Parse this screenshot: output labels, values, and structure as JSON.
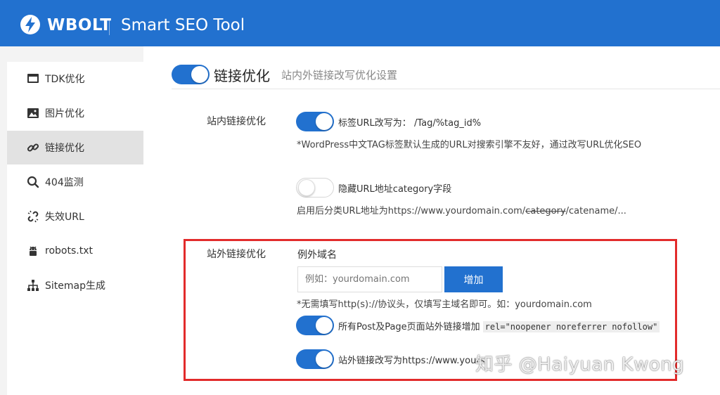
{
  "header": {
    "brand": "WBOLT",
    "product": "Smart SEO Tool",
    "accent_color": "#2271cf",
    "logo_icon": "lightning-bolt-icon"
  },
  "sidebar": {
    "items": [
      {
        "label": "TDK优化",
        "icon": "monitor-icon",
        "active": false
      },
      {
        "label": "图片优化",
        "icon": "image-icon",
        "active": false
      },
      {
        "label": "链接优化",
        "icon": "link-icon",
        "active": true
      },
      {
        "label": "404监测",
        "icon": "search-icon",
        "active": false
      },
      {
        "label": "失效URL",
        "icon": "broken-link-icon",
        "active": false
      },
      {
        "label": "robots.txt",
        "icon": "android-icon",
        "active": false
      },
      {
        "label": "Sitemap生成",
        "icon": "sitemap-icon",
        "active": false
      }
    ]
  },
  "main": {
    "title": "链接优化",
    "subtitle": "站内外链接改写优化设置",
    "title_toggle_on": true,
    "internal": {
      "label": "站内链接优化",
      "tag_toggle_on": true,
      "tag_label": "标签URL改写为：",
      "tag_value": "/Tag/%tag_id%",
      "tag_hint": "*WordPress中文TAG标签默认生成的URL对搜索引擎不友好，通过改写URL优化SEO",
      "category_toggle_on": false,
      "category_label": "隐藏URL地址category字段",
      "category_hint_prefix": "启用后分类URL地址为https://www.yourdomain.com/",
      "category_hint_strike": "category",
      "category_hint_suffix": "/catename/..."
    },
    "external": {
      "label": "站外链接优化",
      "exclude_label": "例外域名",
      "input_placeholder": "例如：yourdomain.com",
      "add_button": "增加",
      "input_hint": "*无需填写http(s)://协议头，仅填写主域名即可。如：yourdomain.com",
      "rel_toggle_on": true,
      "rel_label": "所有Post及Page页面站外链接增加",
      "rel_code": "rel=\"noopener noreferrer nofollow\"",
      "rewrite_toggle_on": true,
      "rewrite_label": "站外链接改写为https://www.yours"
    }
  },
  "watermark": "知乎 @Haiyuan Kwong",
  "highlight_color": "#e22b2b"
}
